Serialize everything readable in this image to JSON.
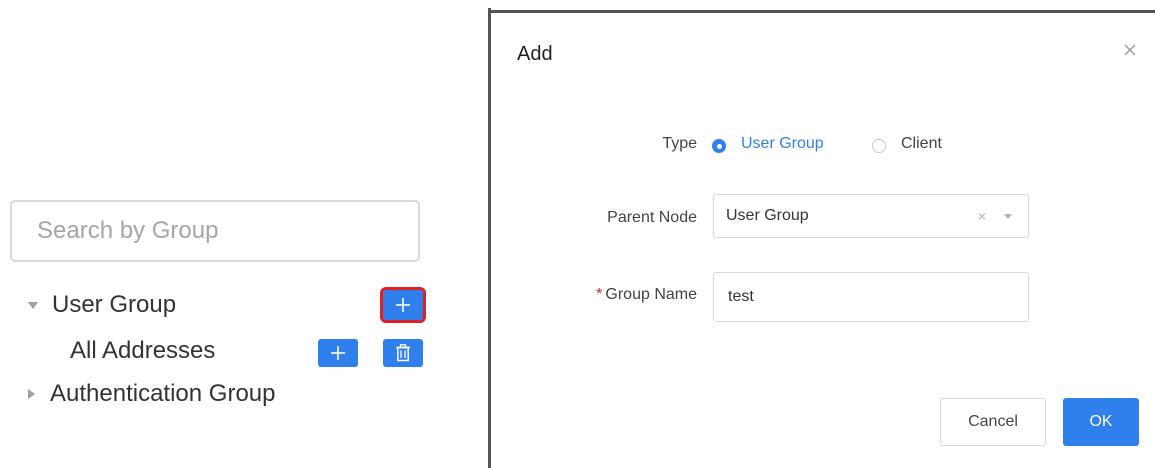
{
  "tree": {
    "search": {
      "placeholder": "Search by Group",
      "value": ""
    },
    "nodes": [
      {
        "label": "User Group",
        "expanded": true,
        "expander_icon": "caret-down-icon",
        "actions": [
          "add-icon"
        ]
      },
      {
        "label": "All Addresses",
        "expanded": false,
        "expander_icon": "",
        "actions": [
          "add-icon",
          "delete-icon"
        ]
      },
      {
        "label": "Authentication Group",
        "expanded": false,
        "expander_icon": "caret-right-icon",
        "actions": []
      }
    ],
    "highlighted_action": "user-group-add-button"
  },
  "dialog": {
    "title": "Add",
    "close_icon": "close-icon",
    "type": {
      "label": "Type",
      "options": [
        {
          "label": "User Group",
          "selected": true
        },
        {
          "label": "Client",
          "selected": false
        }
      ]
    },
    "parent_node": {
      "label": "Parent Node",
      "value": "User Group",
      "clear_glyph": "×",
      "arrow_icon": "caret-down-icon"
    },
    "group_name": {
      "required_mark": "*",
      "label": "Group Name",
      "value": "test"
    },
    "buttons": {
      "cancel": "Cancel",
      "ok": "OK"
    }
  },
  "colors": {
    "accent": "#2f80ed",
    "highlight_border": "#e02020",
    "required": "#e02020",
    "text": "#333333",
    "placeholder": "#a6a6a6"
  }
}
